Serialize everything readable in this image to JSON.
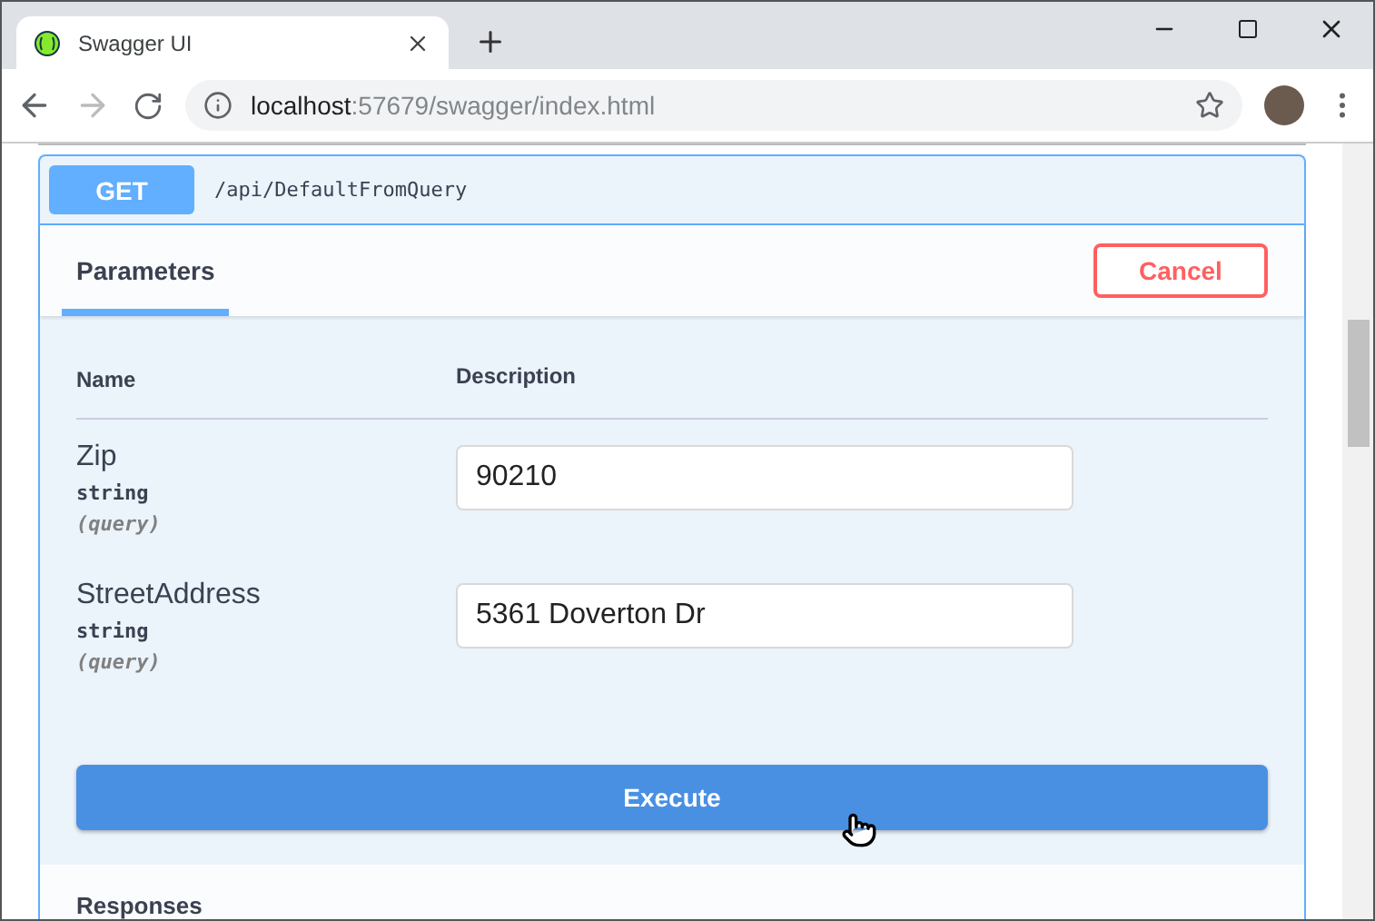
{
  "browser": {
    "tab_title": "Swagger UI",
    "url_host": "localhost",
    "url_rest": ":57679/swagger/index.html"
  },
  "operation": {
    "method": "GET",
    "path": "/api/DefaultFromQuery"
  },
  "section_tab": {
    "label": "Parameters",
    "selected": true
  },
  "cancel_button": "Cancel",
  "columns": [
    "Name",
    "Description"
  ],
  "parameters": [
    {
      "name": "Zip",
      "type": "string",
      "location": "(query)",
      "value": "90210"
    },
    {
      "name": "StreetAddress",
      "type": "string",
      "location": "(query)",
      "value": "5361 Doverton Dr"
    }
  ],
  "execute_button": "Execute",
  "responses_heading": "Responses"
}
